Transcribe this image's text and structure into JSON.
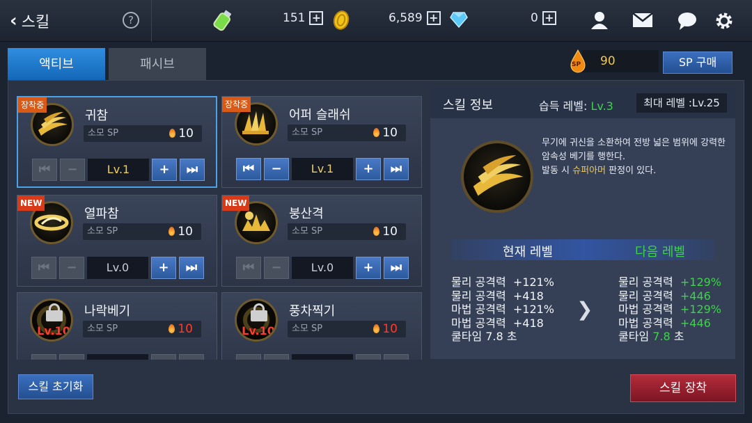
{
  "topbar": {
    "title": "스킬",
    "help": "?",
    "stamina": "151",
    "gold": "6,589",
    "gems": "0",
    "plus": "+"
  },
  "tabs": {
    "active": "액티브",
    "passive": "패시브"
  },
  "sp": {
    "value": "90",
    "buy_label": "SP 구매",
    "drop_label": "SP"
  },
  "skills": [
    {
      "name": "귀참",
      "badge": "장착중",
      "sp_label": "소모 SP",
      "sp": "10",
      "level": "Lv.1"
    },
    {
      "name": "어퍼 슬래쉬",
      "badge": "장착중",
      "sp_label": "소모 SP",
      "sp": "10",
      "level": "Lv.1"
    },
    {
      "name": "열파참",
      "badge": "NEW",
      "sp_label": "소모 SP",
      "sp": "10",
      "level": "Lv.0"
    },
    {
      "name": "붕산격",
      "badge": "NEW",
      "sp_label": "소모 SP",
      "sp": "10",
      "level": "Lv.0"
    },
    {
      "name": "나락베기",
      "sp_label": "소모 SP",
      "sp": "10",
      "lock_level": "Lv.10"
    },
    {
      "name": "풍차찍기",
      "sp_label": "소모 SP",
      "sp": "10",
      "lock_level": "Lv.10"
    }
  ],
  "info": {
    "title": "스킬 정보",
    "learn_label": "습득 레벨:",
    "learn_level": "Lv.3",
    "max_level": "최대 레벨 :Lv.25",
    "desc1": "무기에 귀신을 소환하여 전방 넓은 범위에 강력한 암속성 베기를 행한다.",
    "desc2_pre": "발동 시 ",
    "desc2_hl": "슈퍼아머",
    "desc2_post": " 판정이 있다.",
    "current_label": "현재 레벨",
    "next_label": "다음 레벨",
    "current_stats": [
      {
        "label": "물리 공격력",
        "value": "+121%"
      },
      {
        "label": "물리 공격력",
        "value": "+418"
      },
      {
        "label": "마법 공격력",
        "value": "+121%"
      },
      {
        "label": "마법 공격력",
        "value": "+418"
      }
    ],
    "current_cooldown": "쿨타임 7.8 초",
    "next_stats": [
      {
        "label": "물리 공격력",
        "value": "+129%"
      },
      {
        "label": "물리 공격력",
        "value": "+446"
      },
      {
        "label": "마법 공격력",
        "value": "+129%"
      },
      {
        "label": "마법 공격력",
        "value": "+446"
      }
    ],
    "next_cooldown_label": "쿨타임",
    "next_cooldown_value": "7.8",
    "next_cooldown_unit": "초"
  },
  "buttons": {
    "reset": "스킬 초기화",
    "equip": "스킬 장착"
  },
  "colors": {
    "accent": "#2f8ee0",
    "green": "#3fd24b",
    "red": "#ff3b2f",
    "equip": "#b42c3b"
  }
}
